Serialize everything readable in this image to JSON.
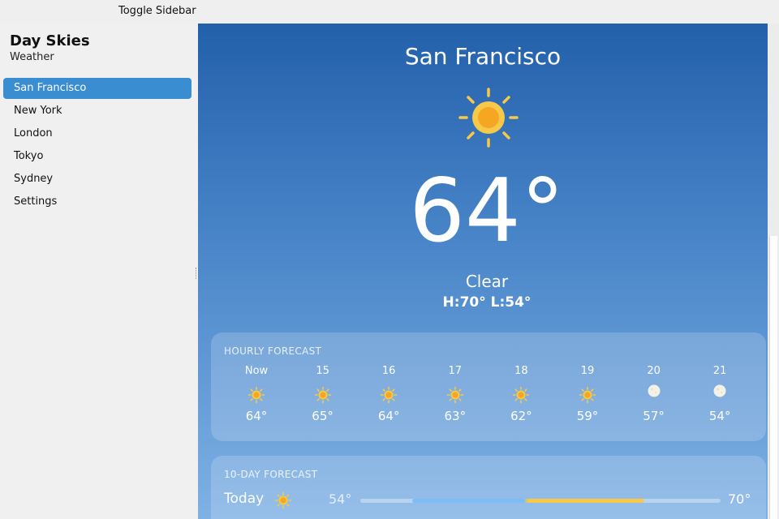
{
  "topbar": {
    "toggle_label": "Toggle Sidebar"
  },
  "sidebar": {
    "title": "Day Skies",
    "subtitle": "Weather",
    "items": [
      {
        "label": "San Francisco",
        "active": true
      },
      {
        "label": "New York"
      },
      {
        "label": "London"
      },
      {
        "label": "Tokyo"
      },
      {
        "label": "Sydney"
      },
      {
        "label": "Settings"
      }
    ]
  },
  "current": {
    "city": "San Francisco",
    "icon": "sun-icon",
    "temp": "64°",
    "condition": "Clear",
    "hilo": "H:70° L:54°"
  },
  "hourly": {
    "title": "HOURLY FORECAST",
    "hours": [
      {
        "label": "Now",
        "icon": "sun-icon",
        "temp": "64°"
      },
      {
        "label": "15",
        "icon": "sun-icon",
        "temp": "65°"
      },
      {
        "label": "16",
        "icon": "sun-icon",
        "temp": "64°"
      },
      {
        "label": "17",
        "icon": "sun-icon",
        "temp": "63°"
      },
      {
        "label": "18",
        "icon": "sun-icon",
        "temp": "62°"
      },
      {
        "label": "19",
        "icon": "sun-icon",
        "temp": "59°"
      },
      {
        "label": "20",
        "icon": "moon-icon",
        "temp": "57°"
      },
      {
        "label": "21",
        "icon": "moon-icon",
        "temp": "54°"
      }
    ]
  },
  "daily": {
    "title": "10-DAY FORECAST",
    "days": [
      {
        "name": "Today",
        "icon": "sun-icon",
        "low": "54°",
        "high": "70°"
      }
    ]
  },
  "colors": {
    "accent": "#3a8dd0",
    "sun": "#f7c948",
    "sun_core": "#f5a623",
    "sky_top": "#2360ab",
    "sky_bottom": "#7fb1e4"
  }
}
